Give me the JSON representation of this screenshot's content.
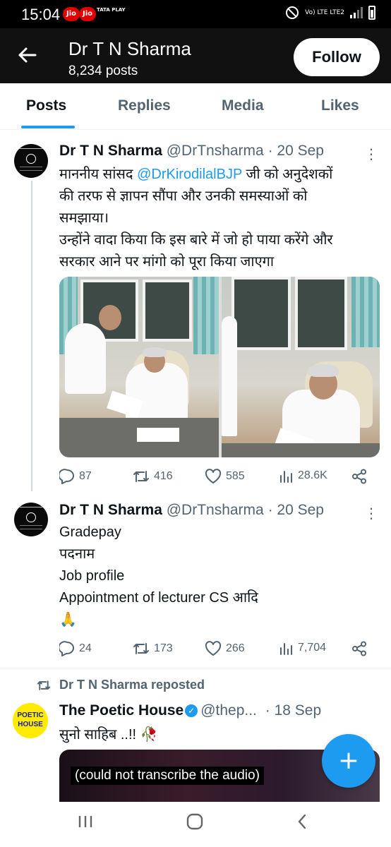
{
  "status_bar": {
    "time": "15:04",
    "carrier1": "Jio",
    "carrier2": "Jio",
    "tata_label": "TATA PLAY",
    "network": "Vo) LTE LTE2"
  },
  "header": {
    "title": "Dr T N Sharma",
    "posts_count": "8,234 posts",
    "follow_label": "Follow"
  },
  "tabs": [
    {
      "label": "Posts",
      "active": true
    },
    {
      "label": "Replies",
      "active": false
    },
    {
      "label": "Media",
      "active": false
    },
    {
      "label": "Likes",
      "active": false
    }
  ],
  "tweets": [
    {
      "name": "Dr T N Sharma",
      "handle": "@DrTnsharma",
      "date": "· 20 Sep",
      "line1_pre": "माननीय सांसद ",
      "line1_mention": "@DrKirodilalBJP",
      "line1_post": " जी को अनुदेशकों",
      "line2": "की तरफ से ज्ञापन सौंपा और उनकी समस्याओं को",
      "line3": "समझाया।",
      "line4": "उन्होंने वादा किया कि इस बारे में जो हो पाया करेंगे और",
      "line5": "सरकार आने पर मांगो को पूरा किया जाएगा",
      "replies": "87",
      "reposts": "416",
      "likes": "585",
      "views": "28.6K"
    },
    {
      "name": "Dr T N Sharma",
      "handle": "@DrTnsharma",
      "date": "· 20 Sep",
      "line1": "Gradepay",
      "line2": "पदनाम",
      "line3": "Job profile",
      "line4": "Appointment of lecturer CS आदि",
      "line5": "🙏",
      "replies": "24",
      "reposts": "173",
      "likes": "266",
      "views": "7,704"
    }
  ],
  "repost": {
    "label": "Dr T N Sharma reposted",
    "name": "The Poetic House",
    "handle": "@thep...",
    "date": "· 18 Sep",
    "text": "सुनो साहिब ..!! 🥀",
    "avatar_text": "POETIC HOUSE",
    "caption": "(could not transcribe the audio)"
  },
  "fab_label": "+",
  "colors": {
    "accent": "#1d9bf0",
    "text": "#0f1419",
    "muted": "#536471",
    "header_bg": "#111111"
  },
  "icons": [
    "back-arrow-icon",
    "reply-icon",
    "repost-icon",
    "like-icon",
    "views-icon",
    "share-icon",
    "more-icon",
    "verified-icon",
    "recents-icon",
    "home-icon",
    "nav-back-icon"
  ]
}
